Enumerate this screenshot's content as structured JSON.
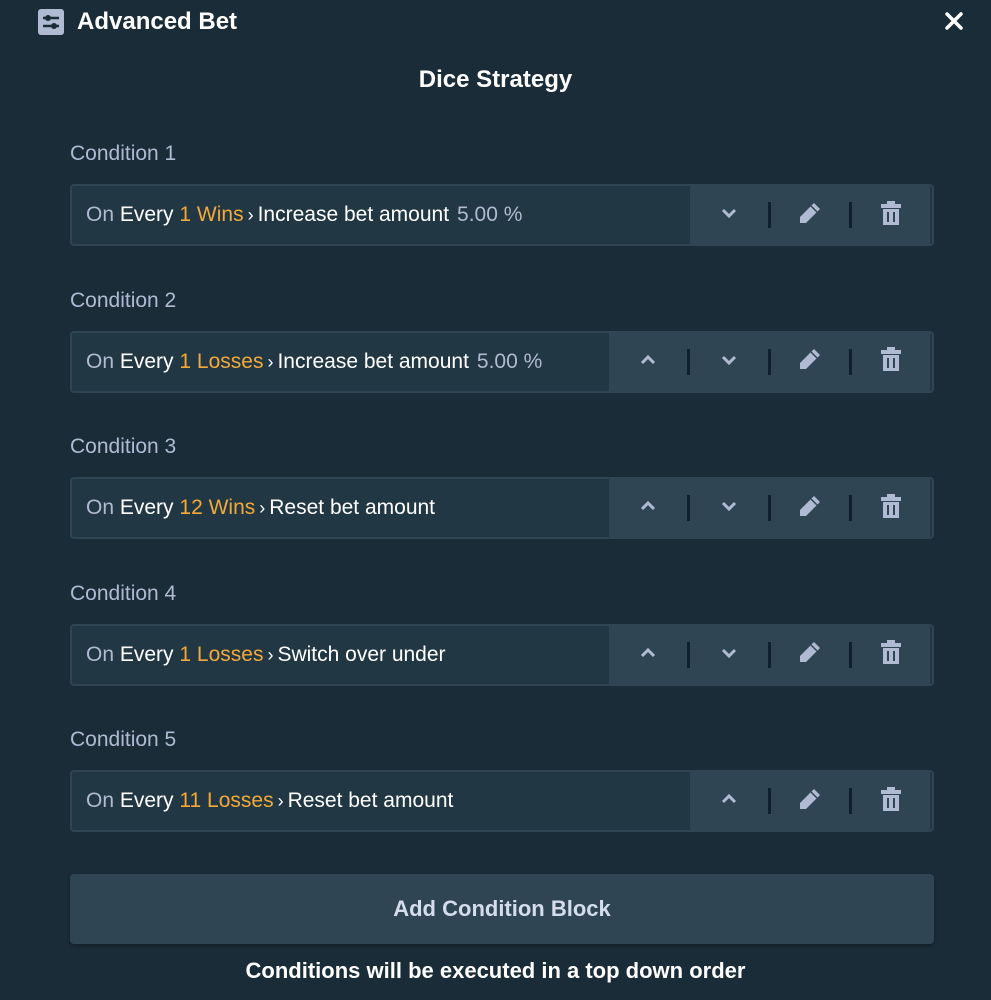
{
  "header": {
    "title": "Advanced Bet",
    "icon": "sliders-icon",
    "close_icon": "close-icon"
  },
  "subtitle": "Dice Strategy",
  "colors": {
    "background": "#1a2c38",
    "box": "#213743",
    "accent": "#f3a93a",
    "muted": "#b1bad3",
    "actions_bg": "#2f4553"
  },
  "conditions": [
    {
      "label": "Condition 1",
      "on": "On",
      "every": "Every",
      "count_event": "1 Wins",
      "action": "Increase bet amount",
      "value": "5.00 %",
      "buttons": [
        "down",
        "edit",
        "delete"
      ]
    },
    {
      "label": "Condition 2",
      "on": "On",
      "every": "Every",
      "count_event": "1 Losses",
      "action": "Increase bet amount",
      "value": "5.00 %",
      "buttons": [
        "up",
        "down",
        "edit",
        "delete"
      ]
    },
    {
      "label": "Condition 3",
      "on": "On",
      "every": "Every",
      "count_event": "12 Wins",
      "action": "Reset bet amount",
      "value": "",
      "buttons": [
        "up",
        "down",
        "edit",
        "delete"
      ]
    },
    {
      "label": "Condition 4",
      "on": "On",
      "every": "Every",
      "count_event": "1 Losses",
      "action": "Switch over under",
      "value": "",
      "buttons": [
        "up",
        "down",
        "edit",
        "delete"
      ]
    },
    {
      "label": "Condition 5",
      "on": "On",
      "every": "Every",
      "count_event": "11 Losses",
      "action": "Reset bet amount",
      "value": "",
      "buttons": [
        "up",
        "edit",
        "delete"
      ]
    }
  ],
  "add_button": "Add Condition Block",
  "footer": "Conditions will be executed in a top down order"
}
